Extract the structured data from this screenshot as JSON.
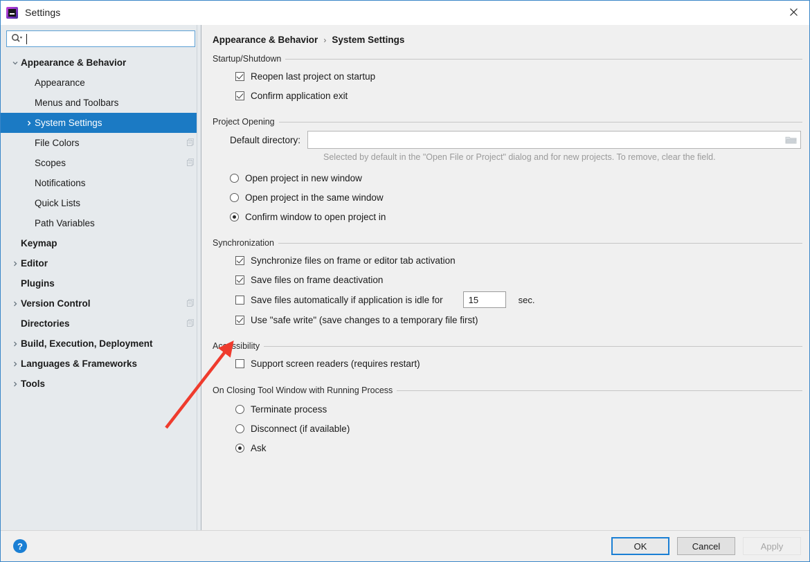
{
  "window": {
    "title": "Settings",
    "app_icon": "pycharm-logo-icon",
    "close_icon": "close-icon"
  },
  "sidebar": {
    "search": {
      "icon": "search-icon",
      "value": "",
      "placeholder": ""
    },
    "items": [
      {
        "label": "Appearance & Behavior",
        "level": 0,
        "bold": true,
        "twisty": "chevron-down",
        "selected": false,
        "copy_icon": false
      },
      {
        "label": "Appearance",
        "level": 1,
        "bold": false,
        "twisty": "",
        "selected": false,
        "copy_icon": false
      },
      {
        "label": "Menus and Toolbars",
        "level": 1,
        "bold": false,
        "twisty": "",
        "selected": false,
        "copy_icon": false
      },
      {
        "label": "System Settings",
        "level": 1,
        "bold": false,
        "twisty": "chevron-right",
        "selected": true,
        "copy_icon": false
      },
      {
        "label": "File Colors",
        "level": 1,
        "bold": false,
        "twisty": "",
        "selected": false,
        "copy_icon": true
      },
      {
        "label": "Scopes",
        "level": 1,
        "bold": false,
        "twisty": "",
        "selected": false,
        "copy_icon": true
      },
      {
        "label": "Notifications",
        "level": 1,
        "bold": false,
        "twisty": "",
        "selected": false,
        "copy_icon": false
      },
      {
        "label": "Quick Lists",
        "level": 1,
        "bold": false,
        "twisty": "",
        "selected": false,
        "copy_icon": false
      },
      {
        "label": "Path Variables",
        "level": 1,
        "bold": false,
        "twisty": "",
        "selected": false,
        "copy_icon": false
      },
      {
        "label": "Keymap",
        "level": 0,
        "bold": true,
        "twisty": "",
        "selected": false,
        "copy_icon": false
      },
      {
        "label": "Editor",
        "level": 0,
        "bold": true,
        "twisty": "chevron-right",
        "selected": false,
        "copy_icon": false
      },
      {
        "label": "Plugins",
        "level": 0,
        "bold": true,
        "twisty": "",
        "selected": false,
        "copy_icon": false
      },
      {
        "label": "Version Control",
        "level": 0,
        "bold": true,
        "twisty": "chevron-right",
        "selected": false,
        "copy_icon": true
      },
      {
        "label": "Directories",
        "level": 0,
        "bold": true,
        "twisty": "",
        "selected": false,
        "copy_icon": true
      },
      {
        "label": "Build, Execution, Deployment",
        "level": 0,
        "bold": true,
        "twisty": "chevron-right",
        "selected": false,
        "copy_icon": false
      },
      {
        "label": "Languages & Frameworks",
        "level": 0,
        "bold": true,
        "twisty": "chevron-right",
        "selected": false,
        "copy_icon": false
      },
      {
        "label": "Tools",
        "level": 0,
        "bold": true,
        "twisty": "chevron-right",
        "selected": false,
        "copy_icon": false
      }
    ]
  },
  "main": {
    "breadcrumb": {
      "parent": "Appearance & Behavior",
      "separator": "›",
      "current": "System Settings"
    },
    "startup": {
      "title": "Startup/Shutdown",
      "reopen_last_project": {
        "label": "Reopen last project on startup",
        "checked": true
      },
      "confirm_exit": {
        "label": "Confirm application exit",
        "checked": true
      }
    },
    "project_opening": {
      "title": "Project Opening",
      "default_directory_label": "Default directory:",
      "default_directory_value": "",
      "default_directory_placeholder": "",
      "browse_icon": "folder-icon",
      "hint": "Selected by default in the \"Open File or Project\" dialog and for new projects. To remove, clear the field.",
      "options": [
        {
          "label": "Open project in new window",
          "selected": false
        },
        {
          "label": "Open project in the same window",
          "selected": false
        },
        {
          "label": "Confirm window to open project in",
          "selected": true
        }
      ]
    },
    "synchronization": {
      "title": "Synchronization",
      "sync_on_activation": {
        "label": "Synchronize files on frame or editor tab activation",
        "checked": true
      },
      "save_on_deactivation": {
        "label": "Save files on frame deactivation",
        "checked": true
      },
      "save_idle": {
        "label": "Save files automatically if application is idle for",
        "checked": false,
        "seconds": "15",
        "unit": "sec."
      },
      "safe_write": {
        "label": "Use \"safe write\" (save changes to a temporary file first)",
        "checked": true
      }
    },
    "accessibility": {
      "title": "Accessibility",
      "screen_readers": {
        "label": "Support screen readers (requires restart)",
        "checked": false
      }
    },
    "closing_tool_window": {
      "title": "On Closing Tool Window with Running Process",
      "options": [
        {
          "label": "Terminate process",
          "selected": false
        },
        {
          "label": "Disconnect (if available)",
          "selected": false
        },
        {
          "label": "Ask",
          "selected": true
        }
      ]
    }
  },
  "footer": {
    "help_icon": "help-question-icon",
    "help_label": "?",
    "ok_label": "OK",
    "cancel_label": "Cancel",
    "apply_label": "Apply",
    "apply_disabled": true
  },
  "annotation": {
    "type": "arrow",
    "color": "#ef3b2d",
    "points_to": "safe-write-checkbox"
  },
  "colors": {
    "selection_blue": "#1b7ac4",
    "accent_blue": "#1a7fd4",
    "sidebar_bg": "#e6eaed",
    "panel_bg": "#f0f0f0",
    "annotation_red": "#ef3b2d"
  }
}
